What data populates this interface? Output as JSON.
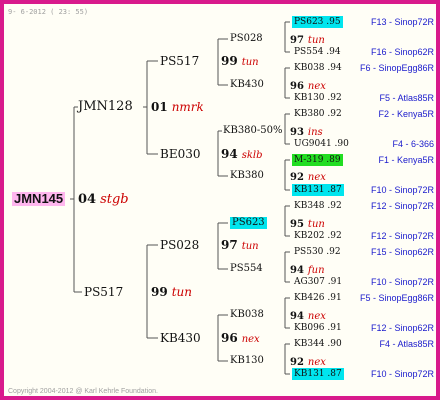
{
  "header": {
    "date": "9- 6-2012 ( 23: 55)"
  },
  "footer": {
    "copyright": "Copyright 2004-2012 @ Karl Kehrle Foundation."
  },
  "colors": {
    "border": "#d81a8c",
    "line": "#555555",
    "pedigree": "#cc0000",
    "source": "#1a1acc",
    "highlight_cyan": "#00e5ee",
    "highlight_green": "#22dd22",
    "highlight_pink": "#ffb6ee"
  },
  "root": {
    "name": "JMN145",
    "num": "04",
    "ped": "stgb"
  },
  "g1": {
    "top": {
      "name": "JMN128",
      "num": "01",
      "ped": "nmrk"
    },
    "bottom": {
      "name": "PS517",
      "num": "99",
      "ped": "tun"
    }
  },
  "g2": {
    "a": {
      "name": "PS517",
      "num": "99",
      "ped": "tun"
    },
    "b": {
      "name": "BE030",
      "num": "94",
      "ped": "sklb"
    },
    "c": {
      "name": "PS028",
      "num": "97",
      "ped": "tun"
    },
    "d": {
      "name": "KB430",
      "num": "96",
      "ped": "nex"
    }
  },
  "g3": {
    "a1": {
      "name": "PS028",
      "num": "97",
      "ped": "tun"
    },
    "a2": {
      "name": "KB430",
      "num": "96",
      "ped": "nex"
    },
    "b1": {
      "name": "KB380-50%",
      "num": "93",
      "ped": "ins"
    },
    "b2": {
      "name": "KB380",
      "num": "92",
      "ped": "nex"
    },
    "c1": {
      "name": "PS623",
      "num": "95",
      "ped": "tun"
    },
    "c2": {
      "name": "PS554",
      "num": "94",
      "ped": "fun"
    },
    "d1": {
      "name": "KB038",
      "num": "94",
      "ped": "nex"
    },
    "d2": {
      "name": "KB130",
      "num": "92",
      "ped": "nex"
    }
  },
  "g4": [
    {
      "name": "PS623 .95",
      "source": "F13 - Sinop72R",
      "hl": "cyan"
    },
    {
      "name": "PS554 .94",
      "source": "F16 - Sinop62R",
      "hl": ""
    },
    {
      "name": "KB038 .94",
      "source": "F6 - SinopEgg86R",
      "hl": ""
    },
    {
      "name": "KB130 .92",
      "source": "F5 - Atlas85R",
      "hl": ""
    },
    {
      "name": "KB380 .92",
      "source": "F2 - Kenya5R",
      "hl": ""
    },
    {
      "name": "UG9041 .90",
      "source": "F4 - 6-366",
      "hl": ""
    },
    {
      "name": "M-319 .89",
      "source": "F1 - Kenya5R",
      "hl": "green"
    },
    {
      "name": "KB131 .87",
      "source": "F10 - Sinop72R",
      "hl": "cyan"
    },
    {
      "name": "KB348 .92",
      "source": "F12 - Sinop72R",
      "hl": ""
    },
    {
      "name": "KB202 .92",
      "source": "F12 - Sinop72R",
      "hl": ""
    },
    {
      "name": "PS530 .92",
      "source": "F15 - Sinop62R",
      "hl": ""
    },
    {
      "name": "AG307 .91",
      "source": "F10 - Sinop72R",
      "hl": ""
    },
    {
      "name": "KB426 .91",
      "source": "F5 - SinopEgg86R",
      "hl": ""
    },
    {
      "name": "KB096 .91",
      "source": "F12 - Sinop62R",
      "hl": ""
    },
    {
      "name": "KB344 .90",
      "source": "F4 - Atlas85R",
      "hl": ""
    },
    {
      "name": "KB131 .87",
      "source": "F10 - Sinop72R",
      "hl": "cyan"
    }
  ]
}
